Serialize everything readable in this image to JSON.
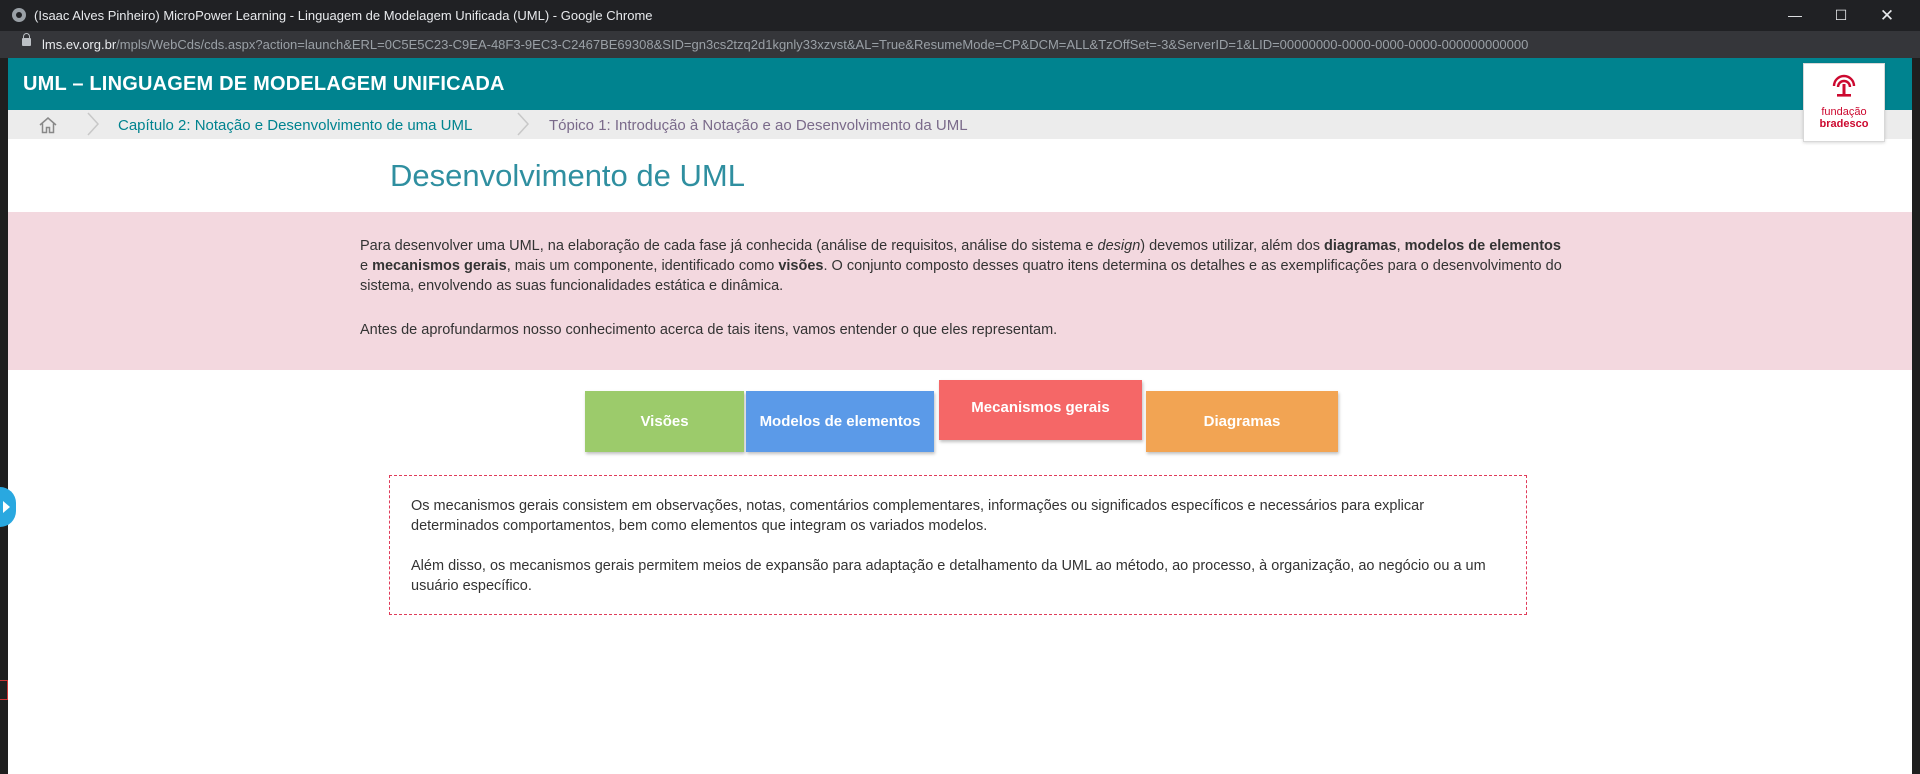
{
  "window": {
    "title": "(Isaac Alves Pinheiro) MicroPower Learning - Linguagem de Modelagem Unificada (UML) - Google Chrome",
    "minimize_glyph": "—",
    "maximize_glyph": "☐",
    "close_glyph": "✕"
  },
  "address_bar": {
    "host": "lms.ev.org.br",
    "path": "/mpls/WebCds/cds.aspx?action=launch&ERL=0C5E5C23-C9EA-48F3-9EC3-C2467BE69308&SID=gn3cs2tzq2d1kgnly33xzvst&AL=True&ResumeMode=CP&DCM=ALL&TzOffSet=-3&ServerID=1&LID=00000000-0000-0000-0000-000000000000"
  },
  "header": {
    "title": "UML – LINGUAGEM DE MODELAGEM UNIFICADA",
    "color": "#00838f"
  },
  "logo": {
    "line1": "fundação",
    "line2": "bradesco",
    "color": "#cc092f"
  },
  "breadcrumb": {
    "home_icon": "home-icon",
    "items": [
      "Capítulo 2: Notação e Desenvolvimento de uma UML",
      "Tópico 1: Introdução à Notação e ao Desenvolvimento da UML"
    ]
  },
  "page_title": "Desenvolvimento de UML",
  "intro": {
    "p1": [
      {
        "t": "Para desenvolver uma UML, na elaboração de cada fase já conhecida (análise de requisitos, análise do sistema e ",
        "s": "n"
      },
      {
        "t": "design",
        "s": "i"
      },
      {
        "t": ") devemos utilizar, além dos ",
        "s": "n"
      },
      {
        "t": "diagramas",
        "s": "b"
      },
      {
        "t": ", ",
        "s": "n"
      },
      {
        "t": "modelos de elementos",
        "s": "b"
      },
      {
        "t": " e ",
        "s": "n"
      },
      {
        "t": "mecanismos gerais",
        "s": "b"
      },
      {
        "t": ", mais um componente, identificado como ",
        "s": "n"
      },
      {
        "t": "visões",
        "s": "b"
      },
      {
        "t": ". O conjunto composto desses quatro itens determina os detalhes e as exemplificações para o desenvolvimento do sistema, envolvendo as suas funcionalidades estática e dinâmica.",
        "s": "n"
      }
    ],
    "p2": "Antes de aprofundarmos nosso conhecimento acerca de tais itens, vamos entender o que eles representam."
  },
  "tabs": [
    {
      "label": "Visões",
      "color": "#9ccb6b",
      "active": false
    },
    {
      "label": "Modelos de elementos",
      "color": "#5b9ae8",
      "active": false
    },
    {
      "label": "Mecanismos gerais",
      "color": "#f56767",
      "active": true
    },
    {
      "label": "Diagramas",
      "color": "#f2a453",
      "active": false
    }
  ],
  "content": {
    "p1": "Os mecanismos gerais consistem em observações, notas, comentários complementares, informações ou significados específicos e necessários para explicar determinados comportamentos, bem como elementos que integram os variados modelos.",
    "p2": "Além disso, os mecanismos gerais permitem meios de expansão para adaptação e detalhamento da UML ao método, ao processo, à organização, ao negócio ou a um usuário específico."
  }
}
